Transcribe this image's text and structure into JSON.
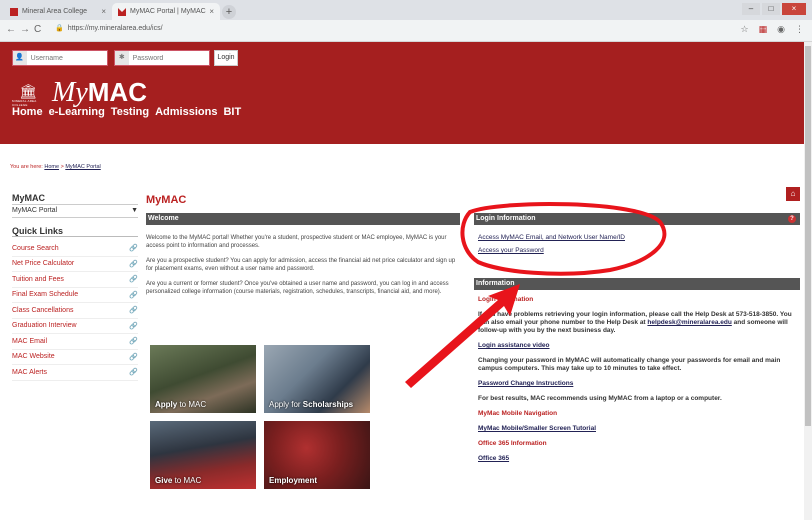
{
  "browser": {
    "tabs": [
      {
        "title": "Mineral Area College"
      },
      {
        "title": "MyMAC Portal | MyMAC"
      }
    ],
    "new_tab": "+",
    "url": "https://my.mineralarea.edu/ics/"
  },
  "header": {
    "username_placeholder": "Username",
    "password_placeholder": "Password",
    "login_label": "Login",
    "logo_my": "My",
    "logo_mac": "MAC",
    "logo_small": "MINERAL AREA COLLEGE",
    "nav": [
      "Home",
      "e-Learning",
      "Testing",
      "Admissions",
      "BIT"
    ]
  },
  "breadcrumb": {
    "prefix": "You are here:",
    "home": "Home",
    "sep": ">",
    "current": "MyMAC Portal"
  },
  "sidebar": {
    "title": "MyMAC",
    "selected": "MyMAC Portal",
    "quick_links_title": "Quick Links",
    "quick_links": [
      "Course Search",
      "Net Price Calculator",
      "Tuition and Fees",
      "Final Exam Schedule",
      "Class Cancellations",
      "Graduation Interview",
      "MAC Email",
      "MAC Website",
      "MAC Alerts"
    ]
  },
  "main": {
    "title": "MyMAC",
    "welcome": {
      "header": "Welcome",
      "paragraphs": [
        "Welcome to the MyMAC portal! Whether you're a student, prospective student or MAC employee, MyMAC is your access point to information and processes.",
        "Are you a prospective student? You can apply for admission, access the financial aid net price calculator and sign up for placement exams, even without a user name and password.",
        "Are you a current or former student? Once you've obtained a user name and password, you can log in and access personalized college information (course materials, registration, schedules, transcripts, financial aid, and more)."
      ]
    },
    "login_info": {
      "header": "Login Information",
      "links": [
        "Access MyMAC Email, and Network User Name/ID",
        "Access your Password"
      ]
    },
    "information": {
      "header": "Information",
      "login_title": "Login Information",
      "help_text": "If you have problems retrieving your login information, please call the Help Desk at 573-518-3850. You can also email your phone number to the Help Desk at",
      "help_email": "helpdesk@mineralarea.edu",
      "help_text2": "and someone will follow-up with you by the next business day.",
      "login_video": "Login assistance video",
      "password_note": "Changing your password in MyMAC will automatically change your passwords for email and main campus computers. This may take up to 10 minutes to take effect.",
      "password_link": "Password Change Instructions",
      "best_results": "For best results, MAC recommends using MyMAC from a laptop or a computer.",
      "mobile_title": "MyMac Mobile Navigation",
      "mobile_link": "MyMac Mobile/Smaller Screen Tutorial",
      "office_title": "Office 365 Information",
      "office_link": "Office 365"
    },
    "tiles": [
      {
        "label_a": "Apply",
        "label_b": " to MAC"
      },
      {
        "label_a": "Apply for ",
        "label_b": "Scholarships"
      },
      {
        "label_a": "Give",
        "label_b": " to MAC"
      },
      {
        "label_a": "",
        "label_b": "Employment"
      }
    ]
  },
  "colors": {
    "brand_red": "#a51f1f",
    "annotation_red": "#e8141b",
    "bar_gray": "#555555"
  }
}
